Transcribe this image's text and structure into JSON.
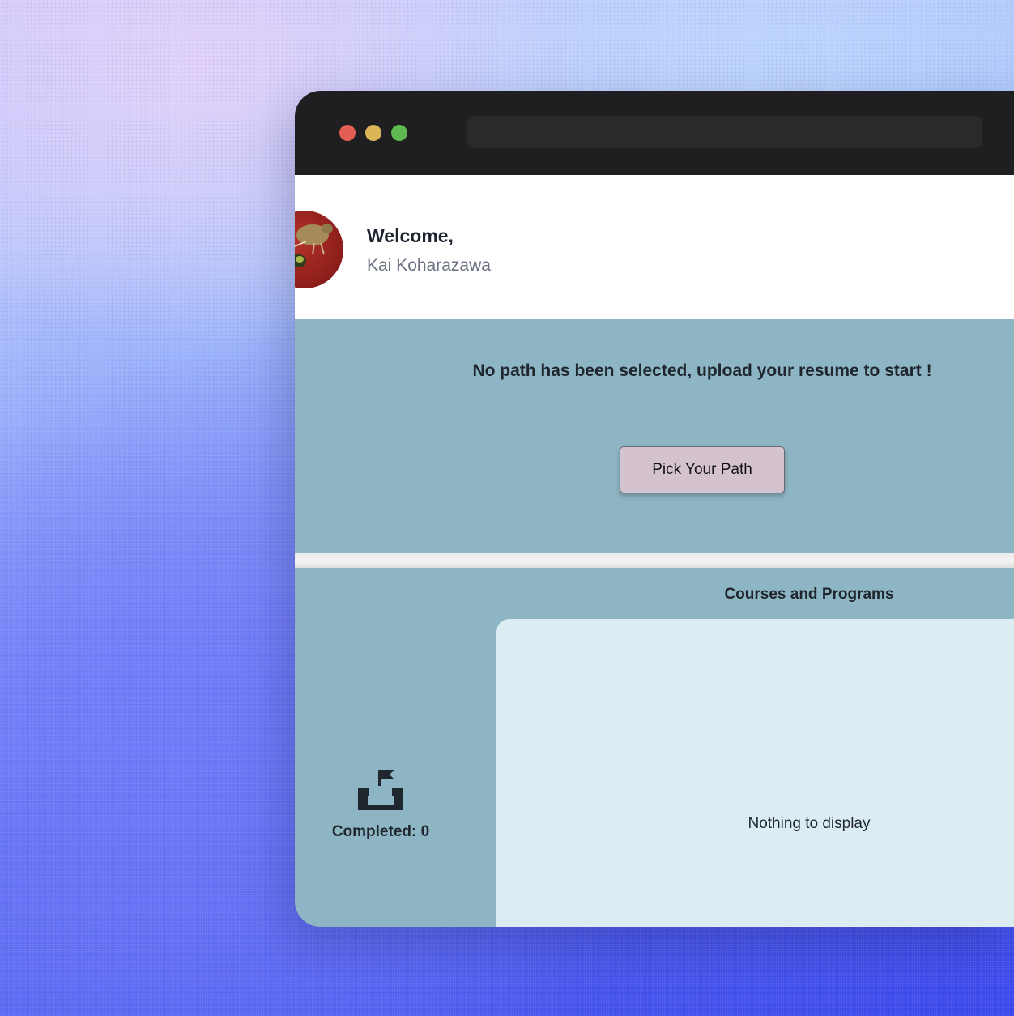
{
  "window": {
    "controls": [
      "close",
      "minimize",
      "maximize"
    ]
  },
  "header": {
    "welcome": "Welcome,",
    "user_name": "Kai Koharazawa"
  },
  "path": {
    "message": "No path has been selected, upload your resume to start !",
    "button_label": "Pick Your Path"
  },
  "courses": {
    "title": "Courses and Programs",
    "empty_text": "Nothing to display"
  },
  "progress": {
    "completed_label": "Completed: 0",
    "icon": "flag-box-icon"
  },
  "colors": {
    "section_bg": "#8eb5c3",
    "panel_bg": "#dbedf3",
    "button_bg": "#d4c3cf",
    "titlebar_bg": "#1f1f21"
  }
}
